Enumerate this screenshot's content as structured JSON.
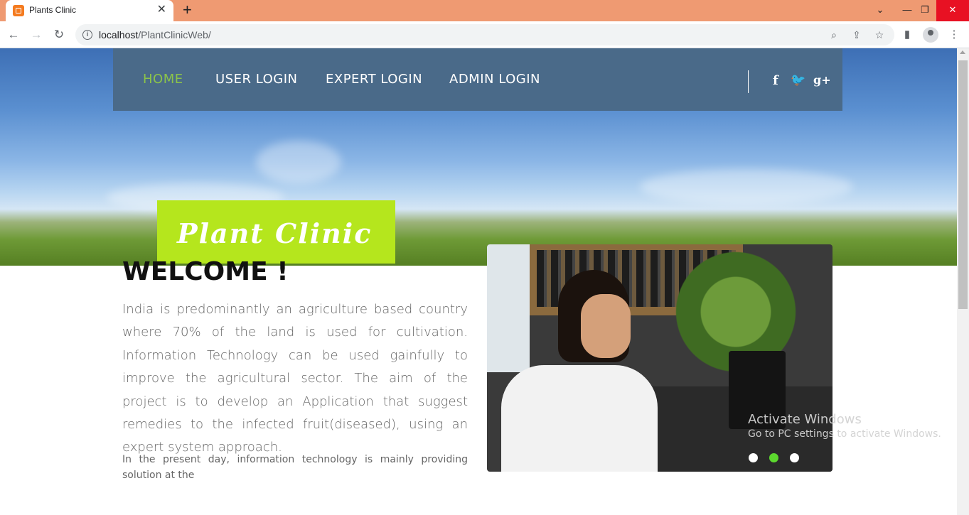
{
  "browser": {
    "tab_title": "Plants Clinic",
    "tab_close": "✕",
    "new_tab": "+",
    "url_host": "localhost",
    "url_path": "/PlantClinicWeb/"
  },
  "nav": {
    "items": [
      "HOME",
      "USER LOGIN",
      "EXPERT LOGIN",
      "ADMIN LOGIN"
    ],
    "active": "HOME",
    "social": [
      "f",
      "🐦",
      "g+"
    ]
  },
  "brand": {
    "title": "Plant Clinic",
    "accent": "#b5e61d"
  },
  "welcome": {
    "title": "WELCOME !",
    "intro": "India is predominantly an agriculture based country where 70% of the land is used for cultivation. Information Technology can be used gainfully to improve the agricultural sector. The aim of the project is to develop an Application that suggest remedies to the infected fruit(diseased), using an expert system approach.",
    "intro2": "In the present day, information technology is mainly providing solution at the"
  },
  "carousel": {
    "slides": 3,
    "active_slide": 2
  },
  "watermark": {
    "title": "Activate Windows",
    "subtitle": "Go to PC settings to activate Windows."
  },
  "colors": {
    "navbar": "#4a6a89",
    "nav_active": "#8bc34a",
    "tabstrip": "#ef9a72"
  }
}
